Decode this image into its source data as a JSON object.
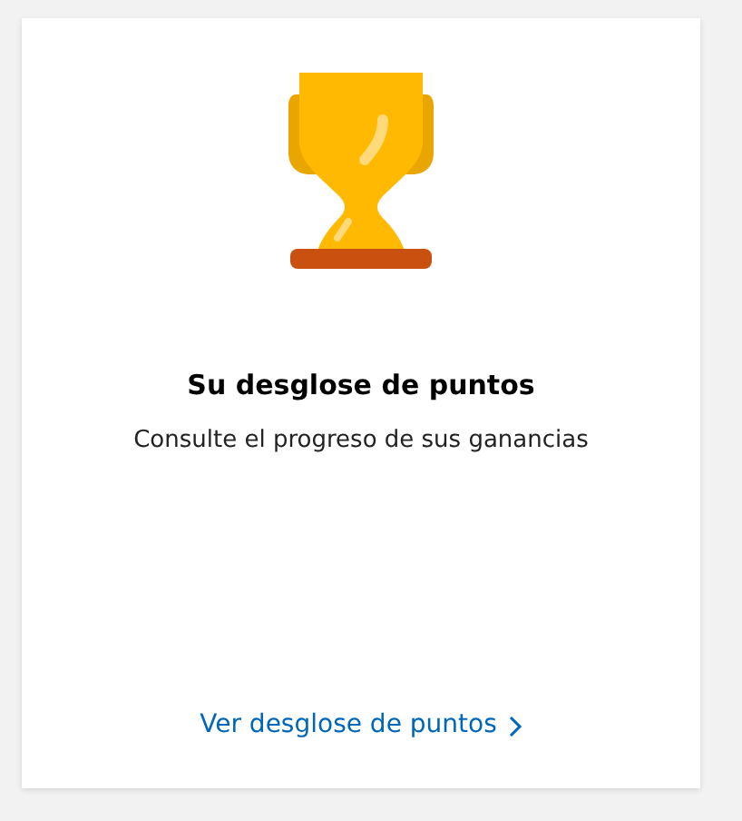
{
  "card": {
    "title": "Su desglose de puntos",
    "description": "Consulte el progreso de sus ganancias",
    "link": "Ver desglose de puntos"
  }
}
